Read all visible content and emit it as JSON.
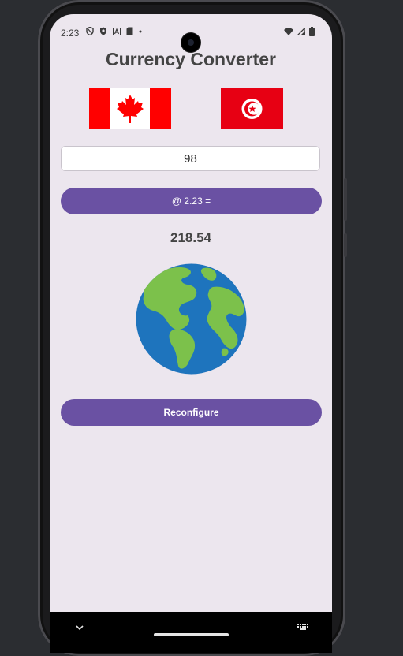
{
  "status_bar": {
    "time": "2:23",
    "left_icons": [
      "vpn-shield-icon",
      "shield-icon",
      "font-icon",
      "sd-card-icon",
      "dot-icon"
    ],
    "right_icons": [
      "wifi-icon",
      "signal-icon",
      "battery-icon"
    ]
  },
  "app": {
    "title": "Currency Converter",
    "from_flag": "canada-flag",
    "to_flag": "tunisia-flag",
    "amount_value": "98",
    "convert_button_label": "@ 2.23 =",
    "result": "218.54",
    "illustration": "globe-icon",
    "reconfigure_button_label": "Reconfigure"
  },
  "colors": {
    "background": "#ece6ee",
    "accent": "#6a51a3",
    "title_text": "#444444"
  },
  "nav_bar": {
    "icons": [
      "chevron-down-icon",
      "home-pill",
      "keyboard-icon"
    ]
  }
}
